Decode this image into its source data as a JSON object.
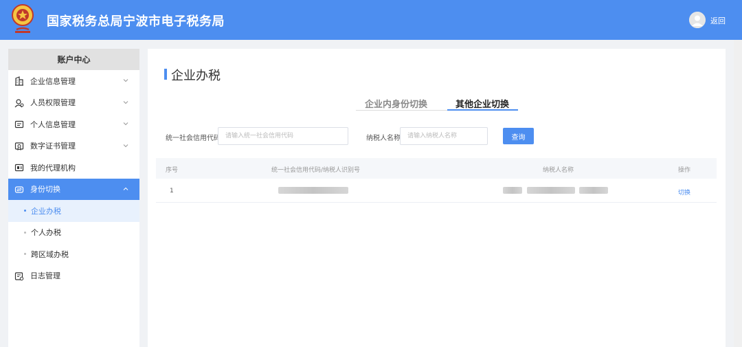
{
  "header": {
    "title": "国家税务总局宁波市电子税务局",
    "back_label": "返回",
    "bg_color": "#4d8ef0"
  },
  "sidebar": {
    "heading": "账户中心",
    "items": [
      {
        "label": "企业信息管理",
        "icon": "building-icon",
        "expandable": true
      },
      {
        "label": "人员权限管理",
        "icon": "user-permission-icon",
        "expandable": true
      },
      {
        "label": "个人信息管理",
        "icon": "id-card-icon",
        "expandable": true
      },
      {
        "label": "数字证书管理",
        "icon": "certificate-icon",
        "expandable": true
      },
      {
        "label": "我的代理机构",
        "icon": "agency-icon",
        "expandable": false
      },
      {
        "label": "身份切换",
        "icon": "switch-icon",
        "expandable": true,
        "active": true
      }
    ],
    "sub_items": [
      {
        "label": "企业办税",
        "active": true
      },
      {
        "label": "个人办税",
        "active": false
      },
      {
        "label": "跨区域办税",
        "active": false
      }
    ],
    "last_item": {
      "label": "日志管理",
      "icon": "log-icon"
    }
  },
  "main": {
    "title": "企业办税",
    "tabs": [
      {
        "label": "企业内身份切换",
        "active": false
      },
      {
        "label": "其他企业切换",
        "active": true
      }
    ],
    "form": {
      "credit_code_label": "统一社会信用代码",
      "credit_code_placeholder": "请输入统一社会信用代码",
      "taxpayer_name_label": "纳税人名称",
      "taxpayer_name_placeholder": "请输入纳税人名称",
      "query_button": "查询"
    },
    "table": {
      "headers": [
        "序号",
        "统一社会信用代码/纳税人识别号",
        "纳税人名称",
        "操作"
      ],
      "rows": [
        {
          "index": "1",
          "action": "切换"
        }
      ]
    }
  }
}
